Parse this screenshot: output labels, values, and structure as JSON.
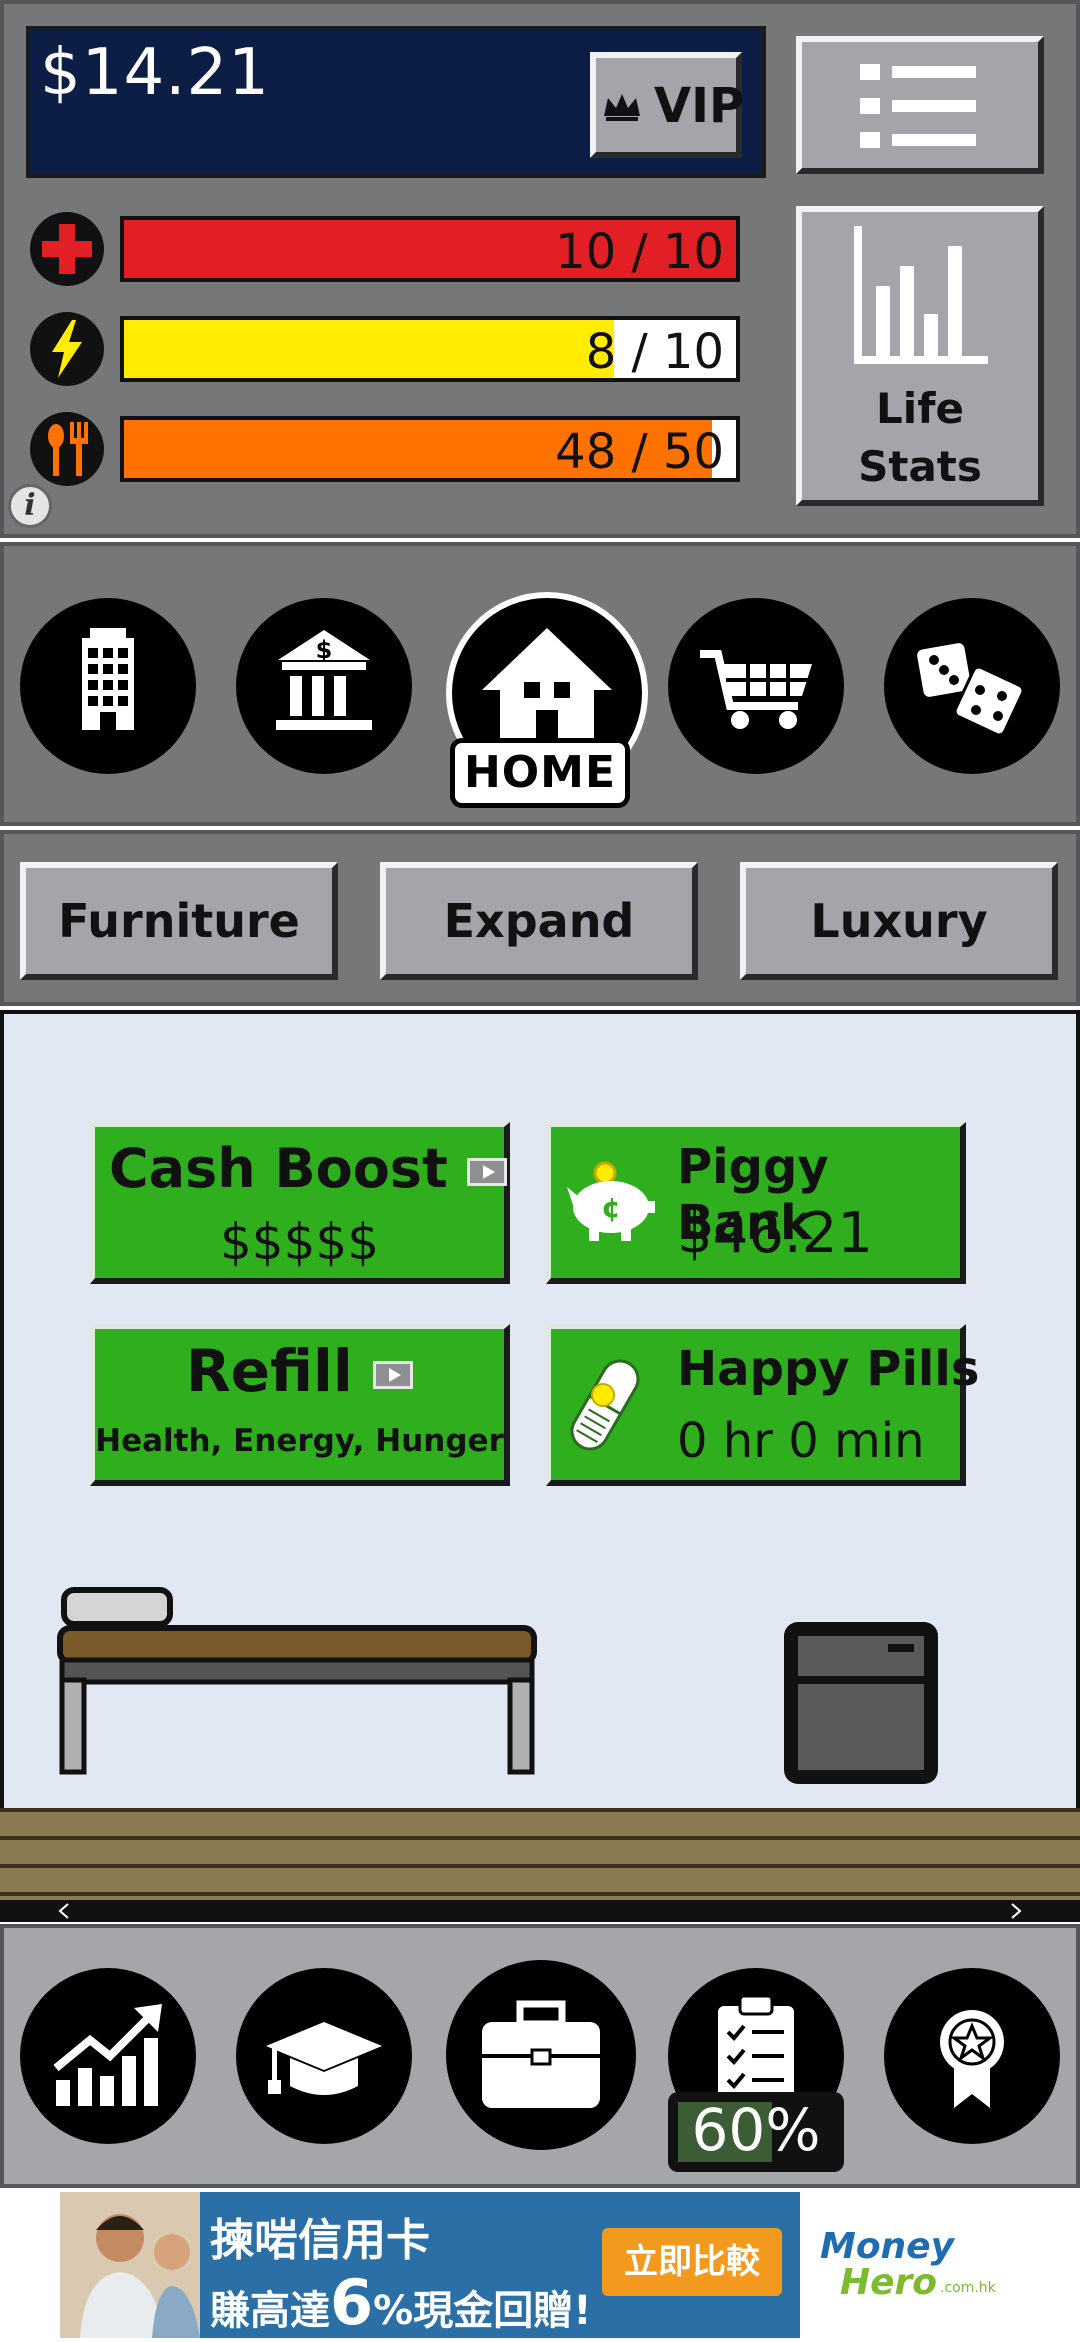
{
  "money": {
    "balance": "$14.21"
  },
  "vip": {
    "label": "VIP"
  },
  "life_stats": {
    "line1": "Life",
    "line2": "Stats"
  },
  "stats": {
    "health": {
      "text": "10 / 10",
      "value": 10,
      "max": 10,
      "color": "#e11f25"
    },
    "energy": {
      "text": "8 / 10",
      "value": 8,
      "max": 10,
      "color": "#ffec00"
    },
    "hunger": {
      "text": "48 / 50",
      "value": 48,
      "max": 50,
      "color": "#ff7200"
    }
  },
  "nav": {
    "items": [
      "office-building-icon",
      "bank-icon",
      "house-icon",
      "shopping-cart-icon",
      "dice-icon"
    ],
    "active_label": "HOME"
  },
  "tabs": [
    "Furniture",
    "Expand",
    "Luxury"
  ],
  "cards": {
    "cash_boost": {
      "title": "Cash Boost",
      "subtitle": "$$$$$"
    },
    "piggy_bank": {
      "title": "Piggy Bank",
      "amount": "$46.21"
    },
    "refill": {
      "title": "Refill",
      "subtitle": "Health, Energy, Hunger"
    },
    "happy_pills": {
      "title": "Happy Pills",
      "time": "0 hr 0 min"
    }
  },
  "bottom_nav": {
    "items": [
      "investment-chart-icon",
      "graduation-cap-icon",
      "briefcase-icon",
      "clipboard-checklist-icon",
      "award-ribbon-icon"
    ],
    "progress_text": "60%",
    "progress": 0.6
  },
  "ad": {
    "headline": "揀啱信用卡",
    "line2_prefix": "賺高達",
    "line2_big": "6",
    "line2_suffix": "%現金回贈!",
    "cta": "立即比較",
    "brand1": "Money",
    "brand2": "Hero",
    "brand_domain": ".com.hk"
  },
  "colors": {
    "card_green": "#2faf1e",
    "panel_gray": "#757779",
    "money_bg": "#0c1e45",
    "room_bg": "#e2e8f3",
    "floor": "#8b7b52"
  }
}
